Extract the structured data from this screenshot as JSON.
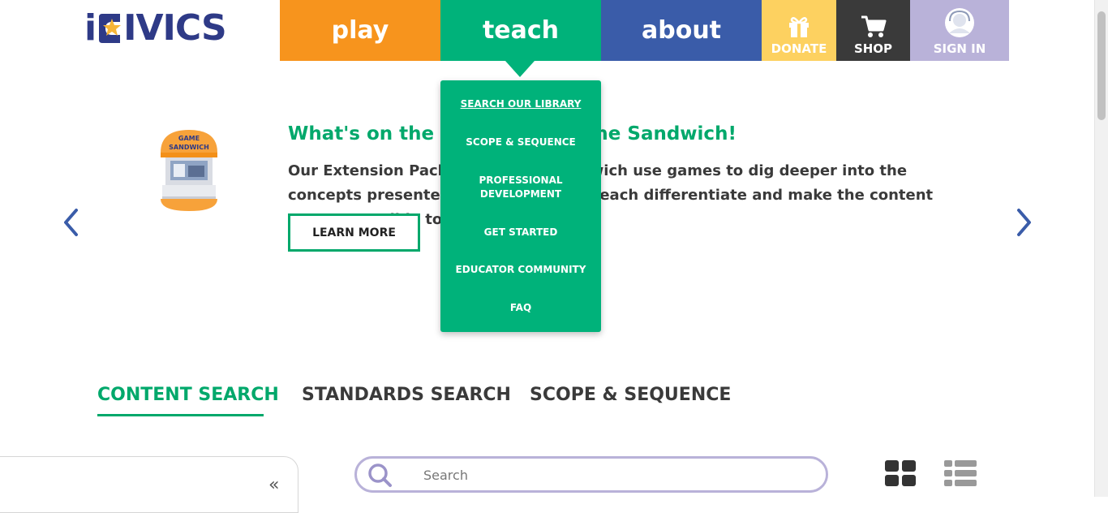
{
  "logo": {
    "text_before_star": "i",
    "text_after_star": "IVICS"
  },
  "nav": {
    "play": "play",
    "teach": "teach",
    "about": "about",
    "donate": "DONATE",
    "shop": "SHOP",
    "signin": "SIGN IN"
  },
  "teach_menu": [
    {
      "label": "SEARCH OUR LIBRARY"
    },
    {
      "label": "SCOPE & SEQUENCE"
    },
    {
      "label": "PROFESSIONAL",
      "label2": "DEVELOPMENT"
    },
    {
      "label": "GET STARTED"
    },
    {
      "label": "EDUCATOR COMMUNITY"
    },
    {
      "label": "FAQ"
    }
  ],
  "hero": {
    "badge_line1": "GAME",
    "badge_line2": "SANDWICH",
    "title": "What's on the Menu? The Game Sandwich!",
    "body": "Our Extension Packs and Game Sandwich use games to dig deeper into the concepts presented, allowing you to teach differentiate and make the content more accessible to all learners.",
    "cta": "LEARN MORE"
  },
  "tabs": [
    {
      "label": "CONTENT SEARCH"
    },
    {
      "label": "STANDARDS SEARCH"
    },
    {
      "label": "SCOPE & SEQUENCE"
    }
  ],
  "search": {
    "placeholder": "Search"
  },
  "collapse_glyph": "«",
  "colors": {
    "play": "#f7941d",
    "teach": "#00b27a",
    "about": "#3a5ca9",
    "donate": "#fdd160",
    "shop": "#3a3a3a",
    "signin": "#b9b2d9",
    "logo": "#2e3a87"
  }
}
